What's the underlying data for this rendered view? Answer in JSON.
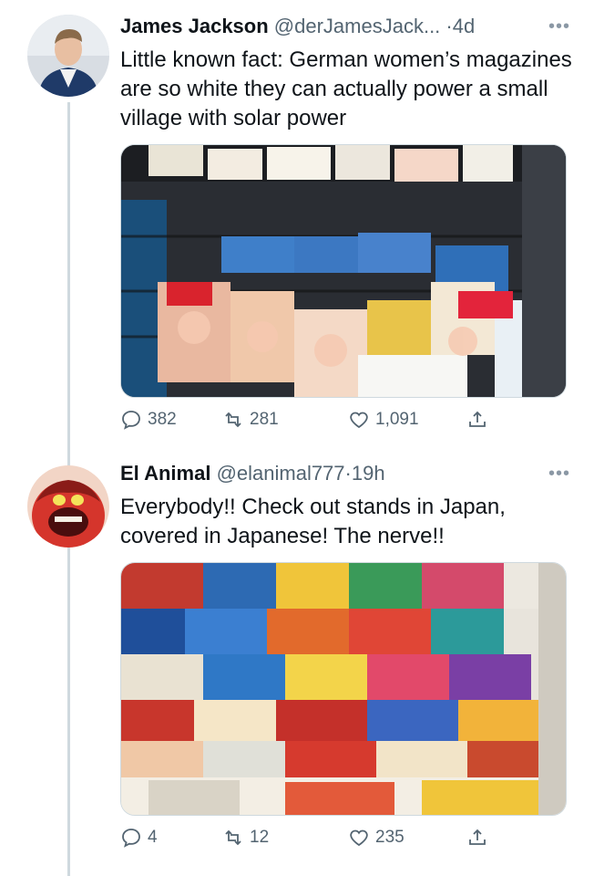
{
  "tweets": [
    {
      "display_name": "James Jackson",
      "handle": "@derJamesJack...",
      "separator": "·",
      "time": "4d",
      "more_icon": "more-horizontal-icon",
      "text": "Little known fact: German women’s magazines are so white they can actually power a small village with solar power",
      "media_icon": "magazine-rack-photo",
      "stats": {
        "replies": "382",
        "retweets": "281",
        "likes": "1,091"
      }
    },
    {
      "display_name": "El Animal",
      "handle": "@elanimal777",
      "separator": "·",
      "time": "19h",
      "more_icon": "more-horizontal-icon",
      "text": "Everybody!! Check out stands in Japan, covered in Japanese! The nerve!!",
      "media_icon": "manga-stand-photo",
      "stats": {
        "replies": "4",
        "retweets": "12",
        "likes": "235"
      }
    }
  ],
  "colors": {
    "text": "#0f1419",
    "secondary": "#536471",
    "thread_line": "#cfd9de"
  }
}
